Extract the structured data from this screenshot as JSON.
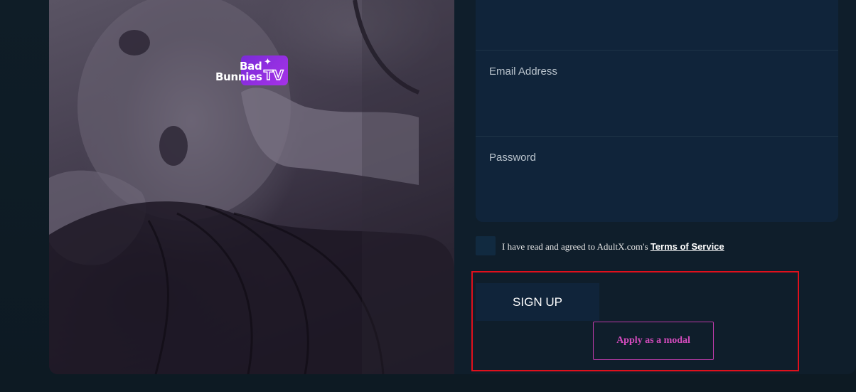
{
  "logo": {
    "line1": "Bad",
    "line2": "Bunnies",
    "suffix": "TV",
    "brand_color": "#8a2be2"
  },
  "form": {
    "email_label": "Email Address",
    "email_value": "",
    "password_label": "Password",
    "password_value": ""
  },
  "terms": {
    "text": "I have read and agreed to AdultX.com's",
    "link": "Terms of Service",
    "checked": false
  },
  "buttons": {
    "signup": "SIGN UP",
    "modal": "Apply as a modal"
  },
  "colors": {
    "page_bg": "#0e1c26",
    "panel_bg": "#10243a",
    "modal_accent": "#d44bbd",
    "highlight": "#e0101c"
  }
}
